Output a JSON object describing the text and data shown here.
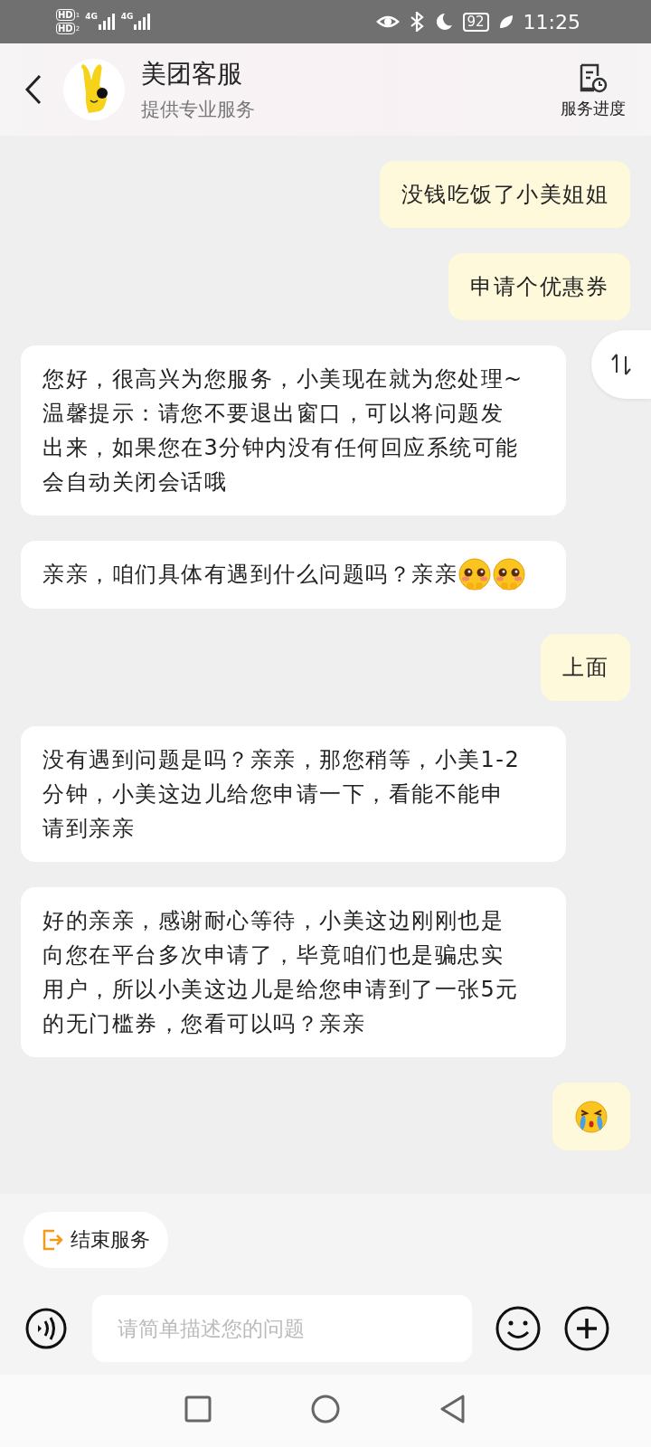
{
  "status_bar": {
    "sims": [
      {
        "badge": "HD",
        "slot": "1",
        "network": "4G"
      },
      {
        "badge": "HD",
        "slot": "2",
        "network": "4G"
      }
    ],
    "battery": "92",
    "time": "11:25"
  },
  "header": {
    "title": "美团客服",
    "subtitle": "提供专业服务",
    "action": "服务进度"
  },
  "messages": [
    {
      "kind": "user",
      "parts": [
        {
          "kind": "text",
          "text": "没钱吃饭了小美姐姐"
        }
      ]
    },
    {
      "kind": "user",
      "parts": [
        {
          "kind": "text",
          "text": "申请个优惠券"
        }
      ]
    },
    {
      "kind": "agent",
      "parts": [
        {
          "kind": "text",
          "text": "您好，很高兴为您服务，小美现在就为您处理~\n温馨提示：请您不要退出窗口，可以将问题发出来，如果您在3分钟内没有任何回应系统可能会自动关闭会话哦"
        }
      ]
    },
    {
      "kind": "agent",
      "parts": [
        {
          "kind": "text",
          "text": "亲亲，咱们具体有遇到什么问题吗？亲亲"
        },
        {
          "kind": "shy_emoji"
        },
        {
          "kind": "shy_emoji"
        }
      ]
    },
    {
      "kind": "user",
      "parts": [
        {
          "kind": "text",
          "text": "上面"
        }
      ]
    },
    {
      "kind": "agent",
      "parts": [
        {
          "kind": "text",
          "text": "没有遇到问题是吗？亲亲，那您稍等，小美1-2分钟，小美这边儿给您申请一下，看能不能申请到亲亲"
        }
      ]
    },
    {
      "kind": "agent",
      "parts": [
        {
          "kind": "text",
          "text": "好的亲亲，感谢耐心等待，小美这边刚刚也是向您在平台多次申请了，毕竟咱们也是骗忠实用户，所以小美这边儿是给您申请到了一张5元的无门槛券，您看可以吗？亲亲"
        }
      ]
    },
    {
      "kind": "user",
      "parts": [
        {
          "kind": "crying_emoji"
        }
      ]
    }
  ],
  "quick_actions": [
    {
      "label": "结束服务"
    }
  ],
  "input": {
    "placeholder": "请简单描述您的问题"
  }
}
